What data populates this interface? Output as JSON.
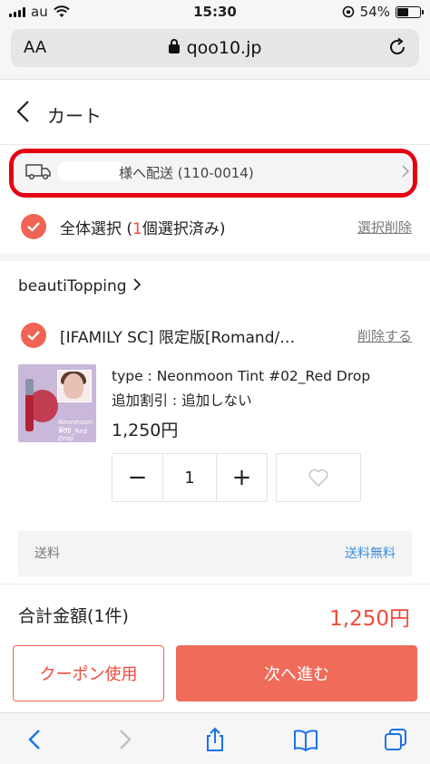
{
  "status_bar": {
    "carrier": "au",
    "time": "15:30",
    "battery": "54%",
    "battery_level": 0.54
  },
  "browser": {
    "text_size_label": "AA",
    "url": "qoo10.jp"
  },
  "header": {
    "title": "カート"
  },
  "delivery": {
    "label": "様へ配送 (110-0014)"
  },
  "select_all": {
    "label_prefix": "全体選択 (",
    "count": "1",
    "label_suffix": "個選択済み)",
    "delete_label": "選択削除"
  },
  "seller": {
    "name": "beautiTopping"
  },
  "item": {
    "title": "[IFAMILY SC] 限定版[Romand/…",
    "delete_label": "削除する",
    "thumb_line1": "Neonmoon Tint",
    "thumb_line2": "#02_Red Drop",
    "option_type": "type : Neonmoon Tint #02_Red Drop",
    "option_discount": "追加割引 : 追加しない",
    "price": "1,250円",
    "quantity": "1",
    "minus": "−",
    "plus": "+"
  },
  "shipping": {
    "label": "送料",
    "value": "送料無料"
  },
  "total": {
    "label": "合計金額(1件)",
    "value": "1,250円"
  },
  "actions": {
    "coupon": "クーポン使用",
    "next": "次へ進む"
  },
  "colors": {
    "accent": "#ef6454",
    "highlight_border": "#e60012",
    "link_blue": "#3b8fde",
    "ios_blue": "#1a73e8"
  },
  "icons": {
    "back": "chevron-left-icon",
    "truck": "truck-icon",
    "wishlist": "heart-icon",
    "share": "share-icon",
    "bookmarks": "book-icon",
    "tabs": "tabs-icon"
  }
}
